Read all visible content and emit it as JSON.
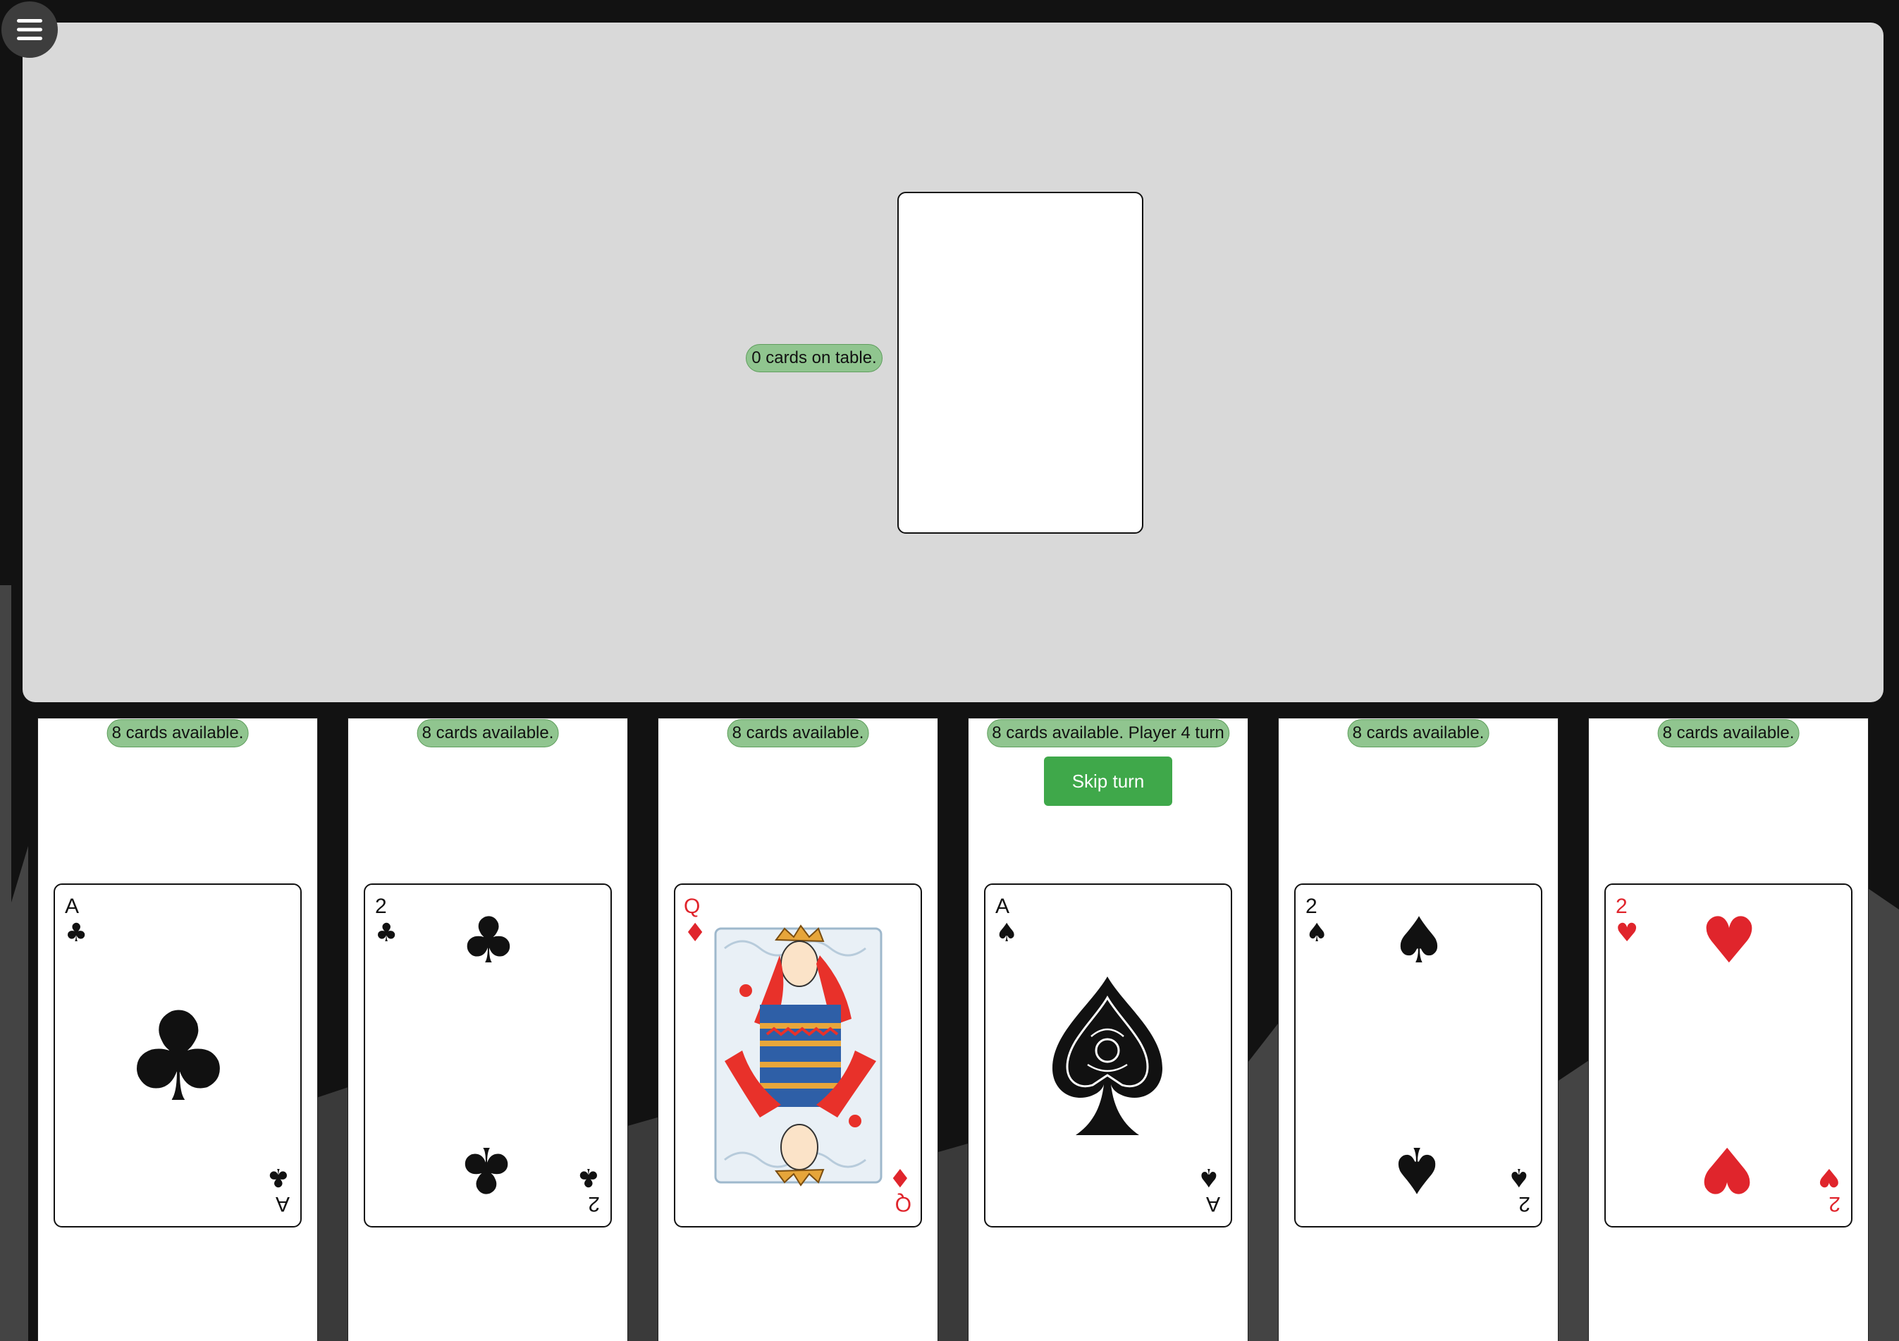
{
  "table": {
    "count_label": "0 cards on table."
  },
  "colors": {
    "red": "#e0252c",
    "black": "#111111",
    "badge": "#90c58f",
    "skip": "#3fa84a"
  },
  "players": [
    {
      "status": "8 cards available.",
      "card": {
        "rank": "A",
        "suit": "clubs",
        "suit_symbol": "♣",
        "color": "black"
      }
    },
    {
      "status": "8 cards available.",
      "card": {
        "rank": "2",
        "suit": "clubs",
        "suit_symbol": "♣",
        "color": "black"
      }
    },
    {
      "status": "8 cards available.",
      "card": {
        "rank": "Q",
        "suit": "diamonds",
        "suit_symbol": "♦",
        "color": "red"
      }
    },
    {
      "status": "8 cards available. Player 4 turn",
      "skip_label": "Skip turn",
      "card": {
        "rank": "A",
        "suit": "spades",
        "suit_symbol": "♠",
        "color": "black"
      }
    },
    {
      "status": "8 cards available.",
      "card": {
        "rank": "2",
        "suit": "spades",
        "suit_symbol": "♠",
        "color": "black"
      }
    },
    {
      "status": "8 cards available.",
      "card": {
        "rank": "2",
        "suit": "hearts",
        "suit_symbol": "♥",
        "color": "red"
      }
    }
  ],
  "icons": {
    "menu": "hamburger-menu-icon"
  }
}
